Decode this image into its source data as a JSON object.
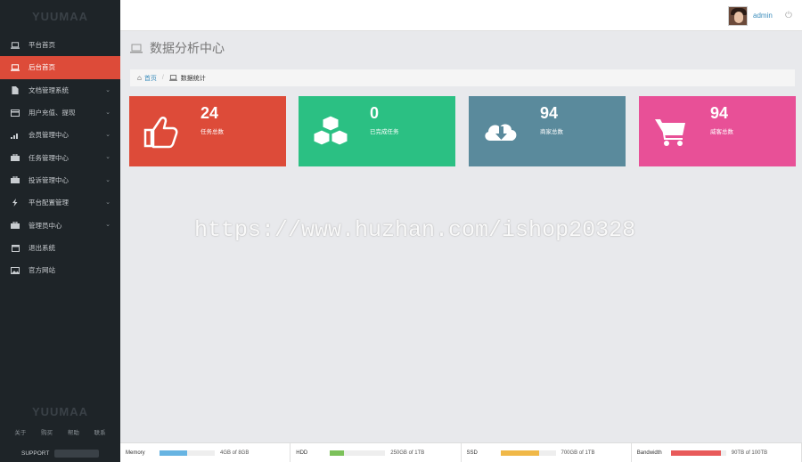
{
  "brand": {
    "logo": "YUUMAA",
    "footer_logo": "YUUMAA"
  },
  "sidebar": {
    "items": [
      {
        "label": "平台首页",
        "icon": "laptop-icon",
        "active": false,
        "has_submenu": false
      },
      {
        "label": "后台首页",
        "icon": "laptop-icon",
        "active": true,
        "has_submenu": false
      },
      {
        "label": "文档管理系统",
        "icon": "file-icon",
        "active": false,
        "has_submenu": true
      },
      {
        "label": "用户充值、提现",
        "icon": "credit-card-icon",
        "active": false,
        "has_submenu": true
      },
      {
        "label": "会员管理中心",
        "icon": "bar-chart-icon",
        "active": false,
        "has_submenu": true
      },
      {
        "label": "任务管理中心",
        "icon": "briefcase-icon",
        "active": false,
        "has_submenu": true
      },
      {
        "label": "投诉管理中心",
        "icon": "briefcase-icon",
        "active": false,
        "has_submenu": true
      },
      {
        "label": "平台配置管理",
        "icon": "bolt-icon",
        "active": false,
        "has_submenu": true
      },
      {
        "label": "管理员中心",
        "icon": "briefcase-icon",
        "active": false,
        "has_submenu": true
      },
      {
        "label": "退出系统",
        "icon": "calendar-icon",
        "active": false,
        "has_submenu": false
      },
      {
        "label": "官方网站",
        "icon": "image-icon",
        "active": false,
        "has_submenu": false
      }
    ],
    "footer_links": [
      "关于",
      "购买",
      "帮助",
      "联系"
    ],
    "support_label": "SUPPORT"
  },
  "header": {
    "username": "admin"
  },
  "page": {
    "title": "数据分析中心"
  },
  "breadcrumb": {
    "home": "首页",
    "current": "数据统计"
  },
  "cards": [
    {
      "value": "24",
      "label": "任务总数",
      "color": "#dd4b39",
      "icon": "thumbs-up-icon"
    },
    {
      "value": "0",
      "label": "已完成任务",
      "color": "#2bc083",
      "icon": "cubes-icon"
    },
    {
      "value": "94",
      "label": "商家总数",
      "color": "#5a8a9c",
      "icon": "cloud-download-icon"
    },
    {
      "value": "94",
      "label": "威客总数",
      "color": "#e85097",
      "icon": "shopping-cart-icon"
    }
  ],
  "watermark": "https://www.huzhan.com/ishop20328",
  "status_bar": [
    {
      "label": "Memory",
      "value": "4GB of 8GB",
      "fill": 0.5,
      "color": "#67b4e2"
    },
    {
      "label": "HDD",
      "value": "250GB of 1TB",
      "fill": 0.25,
      "color": "#7cc15a"
    },
    {
      "label": "SSD",
      "value": "700GB of 1TB",
      "fill": 0.7,
      "color": "#f0b848"
    },
    {
      "label": "Bandwidth",
      "value": "90TB of 100TB",
      "fill": 0.9,
      "color": "#e85a5a"
    }
  ]
}
